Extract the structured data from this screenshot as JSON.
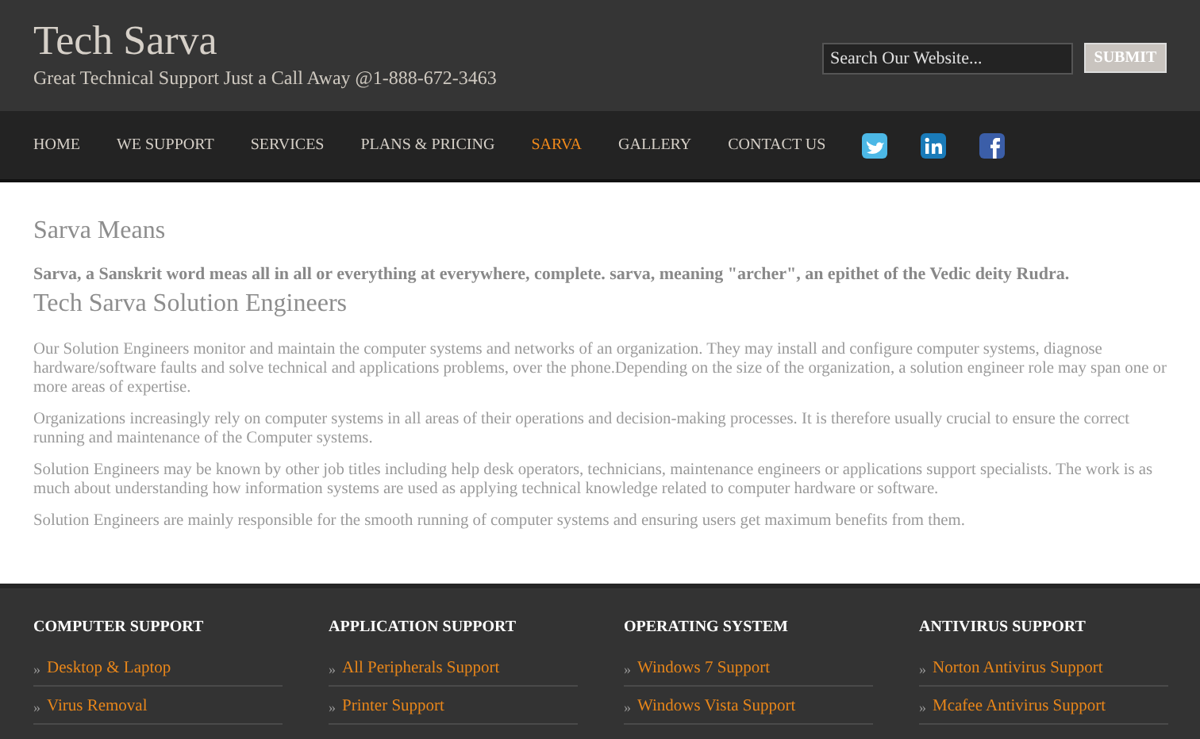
{
  "header": {
    "title": "Tech Sarva",
    "tagline": "Great Technical Support Just a Call Away @1-888-672-3463",
    "search": {
      "placeholder": "Search Our Website..."
    },
    "submit": "SUBMIT"
  },
  "nav": {
    "items": [
      {
        "label": "HOME",
        "selected": false
      },
      {
        "label": "WE SUPPORT",
        "selected": false
      },
      {
        "label": "SERVICES",
        "selected": false
      },
      {
        "label": "PLANS & PRICING",
        "selected": false
      },
      {
        "label": "SARVA",
        "selected": true
      },
      {
        "label": "GALLERY",
        "selected": false
      },
      {
        "label": "CONTACT US",
        "selected": false
      }
    ],
    "social": [
      {
        "kind": "twitter"
      },
      {
        "kind": "linkedin"
      },
      {
        "kind": "facebook"
      }
    ]
  },
  "content": {
    "heading": "Sarva Means",
    "lead": "Sarva, a Sanskrit word meas all in all or everything at everywhere, complete. sarva, meaning \"archer\", an epithet of the Vedic deity Rudra.",
    "subheading": "Tech Sarva Solution Engineers",
    "paragraphs": [
      "Our Solution Engineers monitor and maintain the computer systems and networks of an organization. They may install and configure computer systems, diagnose hardware/software faults and solve technical and applications problems, over the phone.Depending on the size of the organization, a solution engineer role may span one or more areas of expertise.",
      "Organizations increasingly rely on computer systems in all areas of their operations and decision-making processes. It is therefore usually crucial to ensure the correct running and maintenance of the Computer systems.",
      "Solution Engineers may be known by other job titles including help desk operators, technicians, maintenance engineers or applications support specialists. The work is as much about understanding how information systems are used as applying technical knowledge related to computer hardware or software.",
      "Solution Engineers are mainly responsible for the smooth running of computer systems and ensuring users get maximum benefits from them."
    ]
  },
  "footer": {
    "columns": [
      {
        "title": "COMPUTER SUPPORT",
        "links": [
          {
            "marker": "»",
            "label": "Desktop & Laptop"
          },
          {
            "marker": "»",
            "label": "Virus Removal"
          }
        ]
      },
      {
        "title": "APPLICATION SUPPORT",
        "links": [
          {
            "marker": "»",
            "label": "All Peripherals Support"
          },
          {
            "marker": "»",
            "label": "Printer Support"
          }
        ]
      },
      {
        "title": "OPERATING SYSTEM",
        "links": [
          {
            "marker": "»",
            "label": "Windows 7 Support"
          },
          {
            "marker": "»",
            "label": "Windows Vista Support"
          }
        ]
      },
      {
        "title": "ANTIVIRUS SUPPORT",
        "links": [
          {
            "marker": "»",
            "label": "Norton Antivirus Support"
          },
          {
            "marker": "»",
            "label": "Mcafee Antivirus Support"
          }
        ]
      }
    ]
  }
}
